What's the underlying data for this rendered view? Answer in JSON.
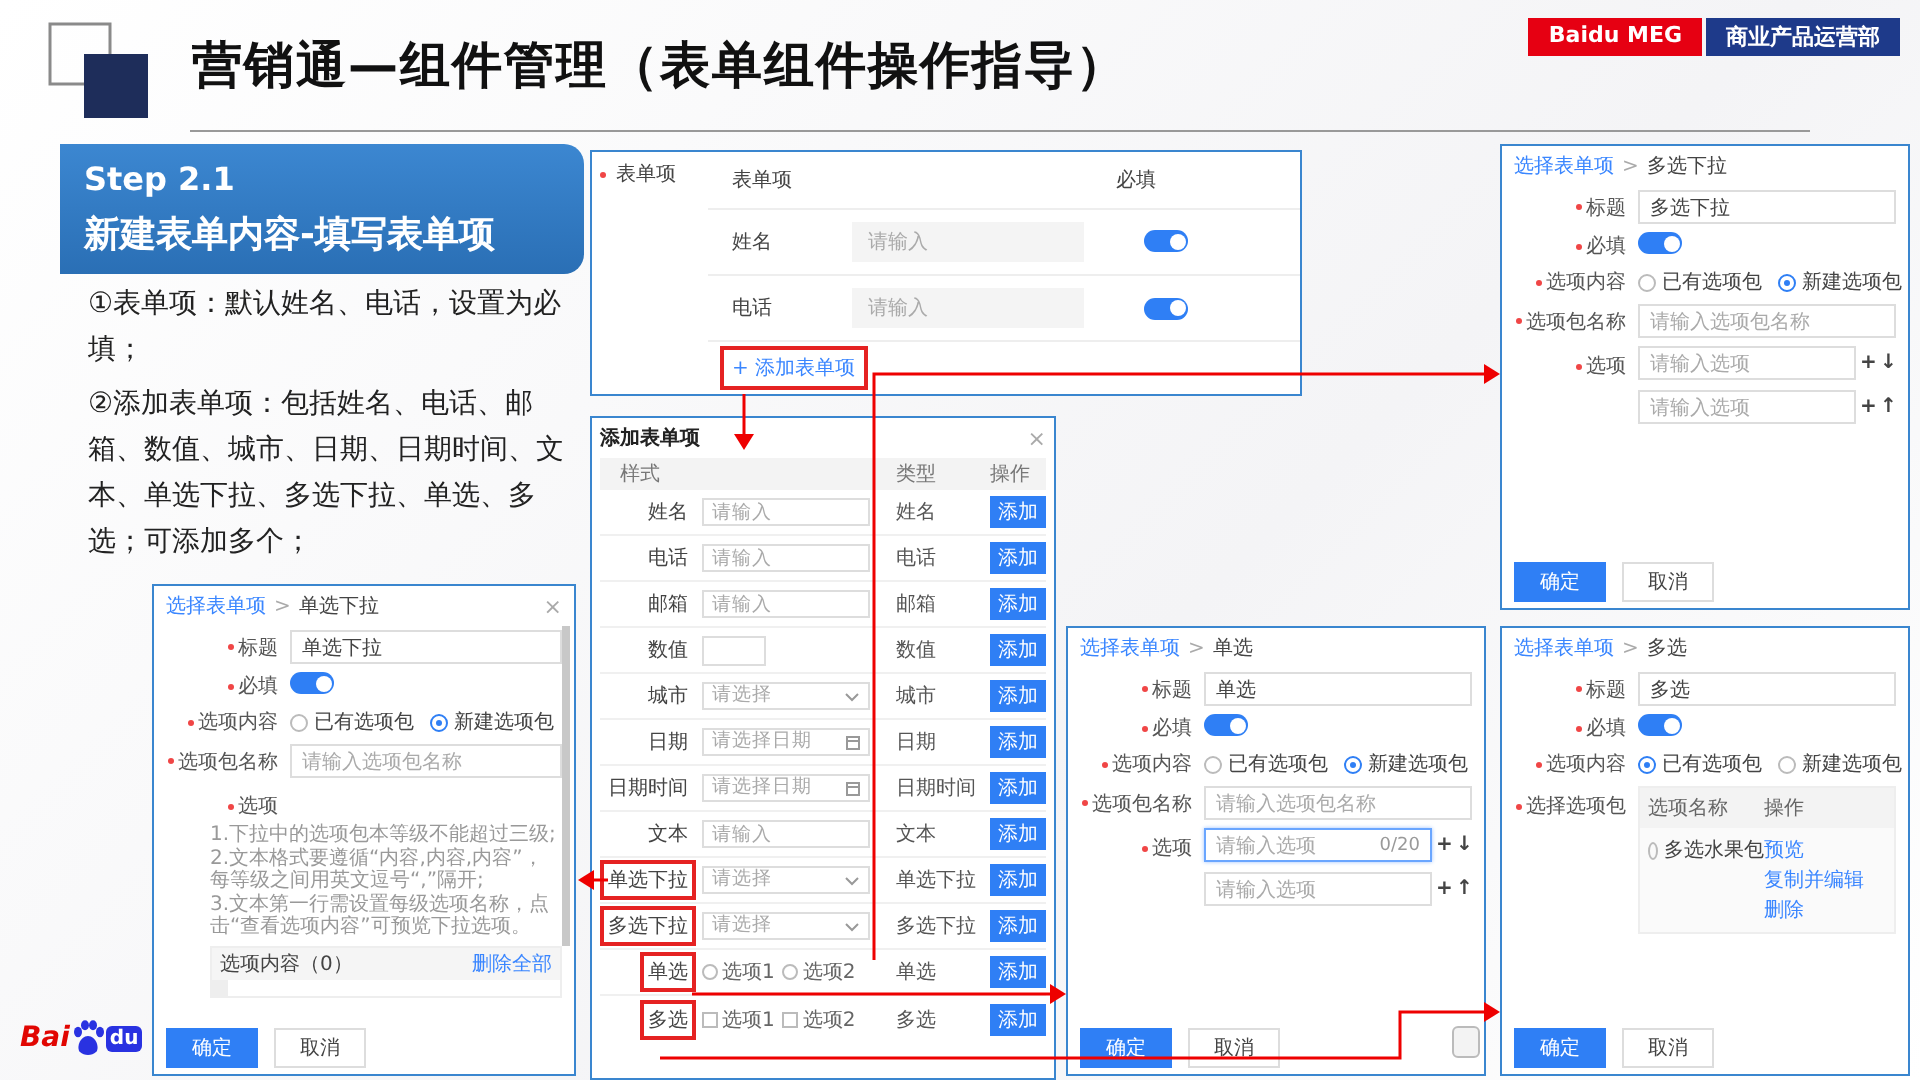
{
  "header": {
    "title": "营销通—组件管理（表单组件操作指导）",
    "badges": [
      {
        "text": "Baidu MEG",
        "color": "#e60012"
      },
      {
        "text": "商业产品运营部",
        "color": "#1e3a8a"
      }
    ]
  },
  "step": {
    "label": "Step 2.1",
    "title": "新建表单内容-填写表单项"
  },
  "instructions": [
    "①表单项：默认姓名、电话，设置为必填；",
    "②添加表单项：包括姓名、电话、邮箱、数值、城市、日期、日期时间、文本、单选下拉、多选下拉、单选、多选；可添加多个；"
  ],
  "logo": {
    "text_1": "Bai",
    "text_2": "du"
  },
  "form_items_panel": {
    "label": "表单项",
    "required": true,
    "columns": [
      "表单项",
      "必填"
    ],
    "rows": [
      {
        "name": "姓名",
        "placeholder": "请输入",
        "on": true
      },
      {
        "name": "电话",
        "placeholder": "请输入",
        "on": true
      }
    ],
    "add_link": {
      "text": "+ 添加表单项",
      "highlighted": true
    }
  },
  "add_dialog": {
    "title": "添加表单项",
    "close": "×",
    "columns": [
      "样式",
      "类型",
      "操作"
    ],
    "rows": [
      {
        "label": "姓名",
        "kind": "input",
        "placeholder": "请输入",
        "type": "姓名",
        "action": "添加",
        "highlighted": false
      },
      {
        "label": "电话",
        "kind": "input",
        "placeholder": "请输入",
        "type": "电话",
        "action": "添加",
        "highlighted": false
      },
      {
        "label": "邮箱",
        "kind": "input",
        "placeholder": "请输入",
        "type": "邮箱",
        "action": "添加",
        "highlighted": false
      },
      {
        "label": "数值",
        "kind": "number",
        "type": "数值",
        "action": "添加",
        "highlighted": false
      },
      {
        "label": "城市",
        "kind": "select",
        "placeholder": "请选择",
        "type": "城市",
        "action": "添加",
        "highlighted": false
      },
      {
        "label": "日期",
        "kind": "date",
        "placeholder": "请选择日期",
        "type": "日期",
        "action": "添加",
        "highlighted": false
      },
      {
        "label": "日期时间",
        "kind": "date",
        "placeholder": "请选择日期",
        "type": "日期时间",
        "action": "添加",
        "highlighted": false
      },
      {
        "label": "文本",
        "kind": "input",
        "placeholder": "请输入",
        "type": "文本",
        "action": "添加",
        "highlighted": false
      },
      {
        "label": "单选下拉",
        "kind": "select",
        "placeholder": "请选择",
        "type": "单选下拉",
        "action": "添加",
        "highlighted": true
      },
      {
        "label": "多选下拉",
        "kind": "select",
        "placeholder": "请选择",
        "type": "多选下拉",
        "action": "添加",
        "highlighted": true
      },
      {
        "label": "单选",
        "kind": "radio",
        "options": [
          {
            "text": "选项1",
            "selected": false
          },
          {
            "text": "选项2",
            "selected": false
          }
        ],
        "type": "单选",
        "action": "添加",
        "highlighted": true
      },
      {
        "label": "多选",
        "kind": "checkbox",
        "options": [
          {
            "text": "选项1",
            "checked": false
          },
          {
            "text": "选项2",
            "checked": false
          }
        ],
        "type": "多选",
        "action": "添加",
        "highlighted": true
      }
    ]
  },
  "config_panels": [
    {
      "breadcrumb": {
        "link": "选择表单项",
        "separator": ">",
        "current": "多选下拉"
      },
      "fields": [
        {
          "kind": "text",
          "label": "标题",
          "required": true,
          "value": "多选下拉"
        },
        {
          "kind": "toggle",
          "label": "必填",
          "required": true,
          "on": true
        },
        {
          "kind": "radio",
          "label": "选项内容",
          "required": true,
          "options": [
            {
              "text": "已有选项包",
              "selected": false
            },
            {
              "text": "新建选项包",
              "selected": true
            }
          ]
        },
        {
          "kind": "text",
          "label": "选项包名称",
          "required": true,
          "placeholder": "请输入选项包名称"
        },
        {
          "kind": "options",
          "label": "选项",
          "required": true,
          "items": [
            {
              "placeholder": "请输入选项",
              "focused": false,
              "actions": [
                "+",
                "↓"
              ]
            },
            {
              "placeholder": "请输入选项",
              "focused": false,
              "actions": [
                "+",
                "↑"
              ]
            }
          ]
        }
      ],
      "buttons": [
        {
          "text": "确定",
          "primary": true
        },
        {
          "text": "取消",
          "primary": false
        }
      ]
    },
    {
      "breadcrumb": {
        "link": "选择表单项",
        "separator": ">",
        "current": "单选下拉"
      },
      "close": "×",
      "fields": [
        {
          "kind": "text",
          "label": "标题",
          "required": true,
          "value": "单选下拉"
        },
        {
          "kind": "toggle",
          "label": "必填",
          "required": true,
          "on": true
        },
        {
          "kind": "radio",
          "label": "选项内容",
          "required": true,
          "options": [
            {
              "text": "已有选项包",
              "selected": false
            },
            {
              "text": "新建选项包",
              "selected": true
            }
          ]
        },
        {
          "kind": "text",
          "label": "选项包名称",
          "required": true,
          "placeholder": "请输入选项包名称"
        },
        {
          "kind": "notes",
          "label": "选项",
          "required": true,
          "notes": [
            "1.下拉中的选项包本等级不能超过三级;",
            "2.文本格式要遵循“内容,内容,内容”，每等级之间用英文逗号“,”隔开;",
            "3.文本第一行需设置每级选项名称，点击“查看选项内容”可预览下拉选项。"
          ],
          "box": {
            "title": "选项内容（0）",
            "action": "删除全部"
          }
        }
      ],
      "buttons": [
        {
          "text": "确定",
          "primary": true
        },
        {
          "text": "取消",
          "primary": false
        }
      ]
    },
    {
      "breadcrumb": {
        "link": "选择表单项",
        "separator": ">",
        "current": "单选"
      },
      "fields": [
        {
          "kind": "text",
          "label": "标题",
          "required": true,
          "value": "单选"
        },
        {
          "kind": "toggle",
          "label": "必填",
          "required": true,
          "on": true
        },
        {
          "kind": "radio",
          "label": "选项内容",
          "required": true,
          "options": [
            {
              "text": "已有选项包",
              "selected": false
            },
            {
              "text": "新建选项包",
              "selected": true
            }
          ]
        },
        {
          "kind": "text",
          "label": "选项包名称",
          "required": true,
          "placeholder": "请输入选项包名称"
        },
        {
          "kind": "options",
          "label": "选项",
          "required": true,
          "items": [
            {
              "placeholder": "请输入选项",
              "focused": true,
              "counter": "0/20",
              "actions": [
                "+",
                "↓"
              ]
            },
            {
              "placeholder": "请输入选项",
              "focused": false,
              "actions": [
                "+",
                "↑"
              ]
            }
          ]
        }
      ],
      "buttons": [
        {
          "text": "确定",
          "primary": true
        },
        {
          "text": "取消",
          "primary": false
        }
      ]
    },
    {
      "breadcrumb": {
        "link": "选择表单项",
        "separator": ">",
        "current": "多选"
      },
      "fields": [
        {
          "kind": "text",
          "label": "标题",
          "required": true,
          "value": "多选"
        },
        {
          "kind": "toggle",
          "label": "必填",
          "required": true,
          "on": true
        },
        {
          "kind": "radio",
          "label": "选项内容",
          "required": true,
          "options": [
            {
              "text": "已有选项包",
              "selected": true
            },
            {
              "text": "新建选项包",
              "selected": false
            }
          ]
        },
        {
          "kind": "table",
          "label": "选择选项包",
          "required": true,
          "columns": [
            "选项名称",
            "操作"
          ],
          "rows": [
            {
              "name": "多选水果包",
              "selected": false,
              "actions": [
                "预览",
                "复制并编辑",
                "删除"
              ]
            }
          ]
        }
      ],
      "buttons": [
        {
          "text": "确定",
          "primary": true
        },
        {
          "text": "取消",
          "primary": false
        }
      ]
    }
  ]
}
